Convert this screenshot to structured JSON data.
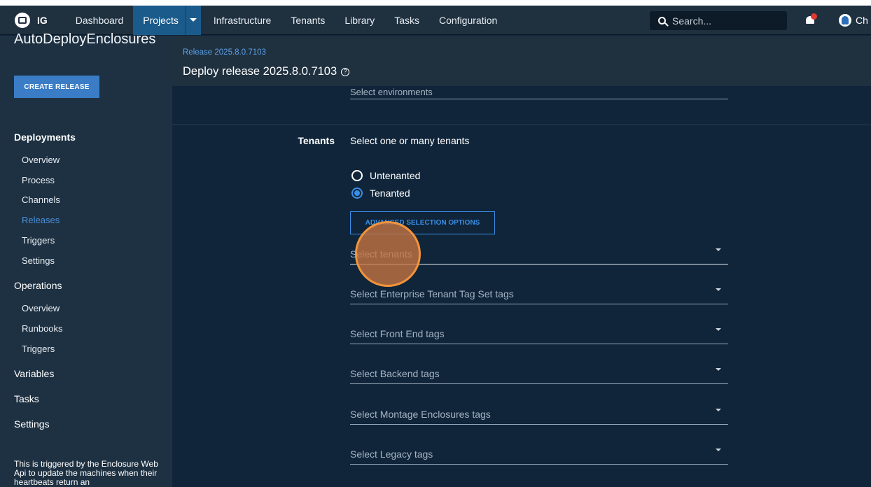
{
  "nav": {
    "logo_text": "IG",
    "items": [
      {
        "label": "Dashboard"
      },
      {
        "label": "Projects"
      },
      {
        "label": "Infrastructure"
      },
      {
        "label": "Tenants"
      },
      {
        "label": "Library"
      },
      {
        "label": "Tasks"
      },
      {
        "label": "Configuration"
      }
    ],
    "active_item": "Projects",
    "search_placeholder": "Search...",
    "user_name": "Ch",
    "notification_color": "#e0392e"
  },
  "sidebar": {
    "project_name": "AutoDeployEnclosures",
    "create_release_label": "CREATE RELEASE",
    "deployments": {
      "title": "Deployments",
      "items": [
        "Overview",
        "Process",
        "Channels",
        "Releases",
        "Triggers",
        "Settings"
      ],
      "active": "Releases"
    },
    "operations": {
      "title": "Operations",
      "items": [
        "Overview",
        "Runbooks",
        "Triggers"
      ]
    },
    "links": [
      "Variables",
      "Tasks",
      "Settings"
    ],
    "note": "This is triggered by the Enclosure Web Api to update the machines when their heartbeats return an"
  },
  "header": {
    "release_link": "Release 2025.8.0.7103",
    "title": "Deploy release 2025.8.0.7103"
  },
  "form": {
    "environments_placeholder": "Select environments",
    "tenants": {
      "label": "Tenants",
      "description": "Select one or many tenants",
      "options": [
        {
          "label": "Untenanted",
          "checked": false
        },
        {
          "label": "Tenanted",
          "checked": true
        }
      ],
      "advanced_label": "ADVANCED SELECTION OPTIONS",
      "selects": [
        "Select tenants",
        "Select Enterprise Tenant Tag Set tags",
        "Select Front End tags",
        "Select Backend tags",
        "Select Montage Enclosures tags",
        "Select Legacy tags"
      ]
    }
  },
  "colors": {
    "accent": "#3a8ee6",
    "nav_active": "#1a5b8c",
    "click_marker": "#f2943a"
  }
}
